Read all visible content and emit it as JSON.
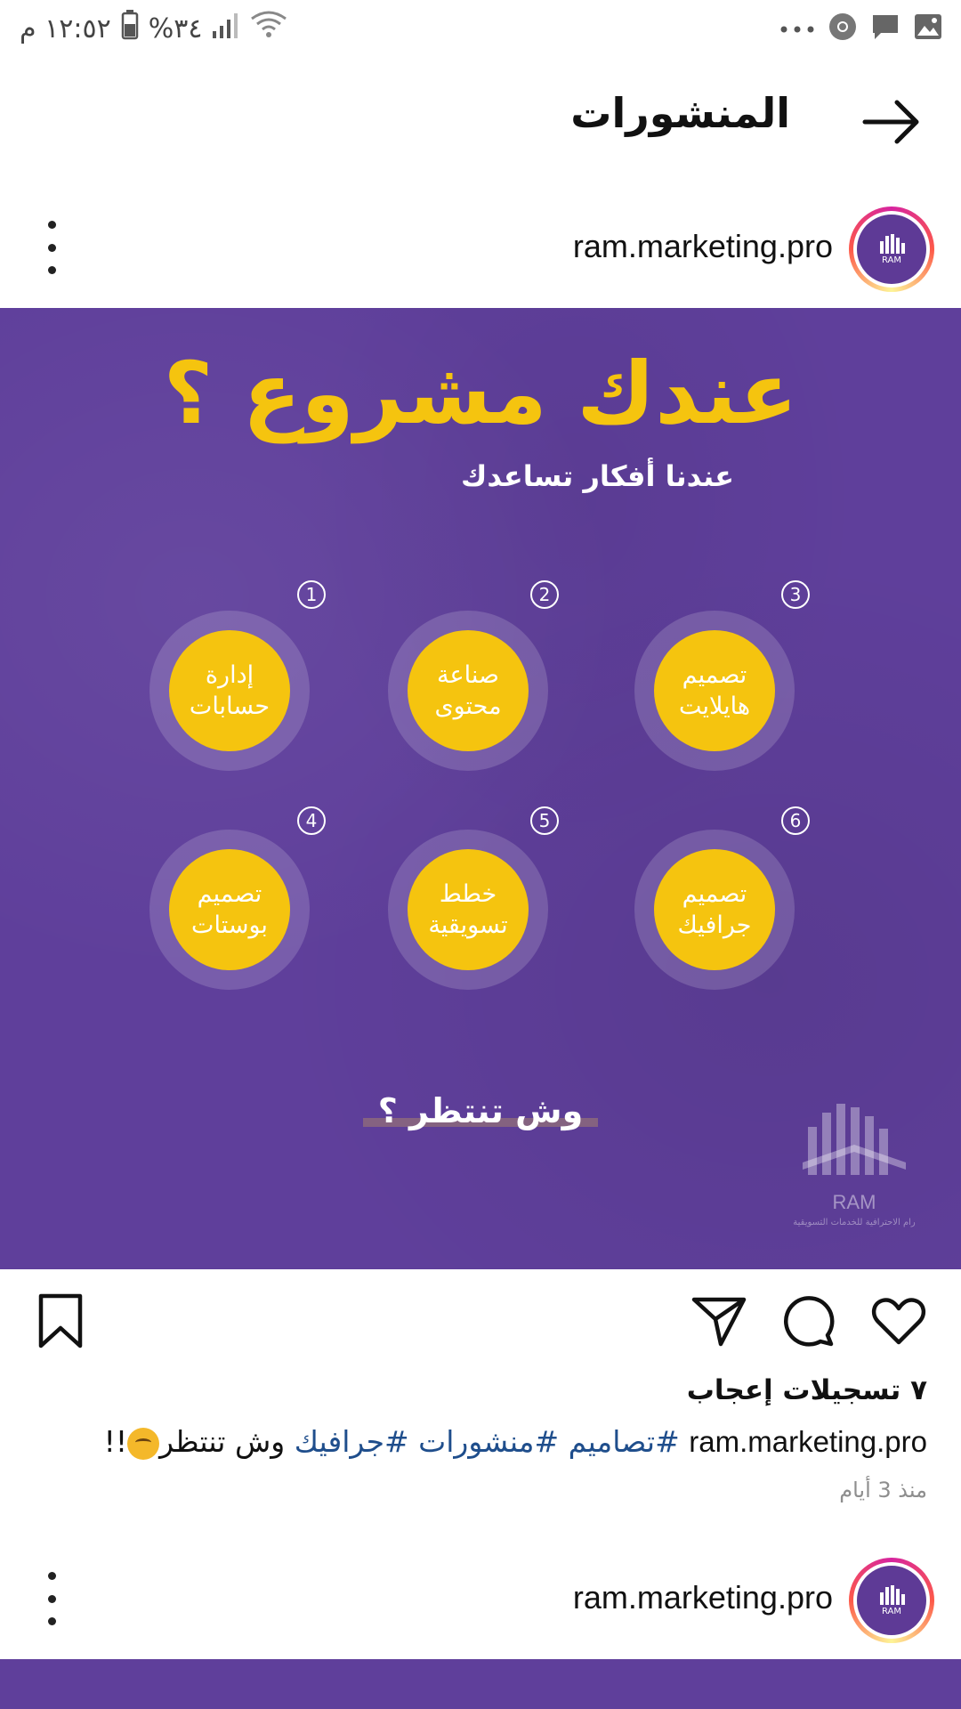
{
  "status_bar": {
    "time": "١٢:٥٢ م",
    "battery": "%٣٤"
  },
  "header": {
    "title": "المنشورات"
  },
  "posts": [
    {
      "username": "ram.marketing.pro",
      "avatar_text": "RAM",
      "image": {
        "title": "عندك مشروع ؟",
        "subtitle": "عندنا أفكار تساعدك",
        "services": [
          {
            "number": "3",
            "line1": "تصميم",
            "line2": "هايلايت"
          },
          {
            "number": "2",
            "line1": "صناعة",
            "line2": "محتوى"
          },
          {
            "number": "1",
            "line1": "إدارة",
            "line2": "حسابات"
          },
          {
            "number": "6",
            "line1": "تصميم",
            "line2": "جرافيك"
          },
          {
            "number": "5",
            "line1": "خطط",
            "line2": "تسويقية"
          },
          {
            "number": "4",
            "line1": "تصميم",
            "line2": "بوستات"
          }
        ],
        "cta": "وش تنتظر ؟",
        "logo_name": "RAM",
        "logo_tagline": "رام الاحترافية للخدمات التسويقية"
      },
      "likes": "٧ تسجيلات إعجاب",
      "caption": {
        "username": "ram.marketing.pro",
        "tags": [
          "#تصاميم",
          "#منشورات",
          "#جرافيك"
        ],
        "text": "وش تنتظر",
        "suffix": "!!"
      },
      "time_ago": "منذ 3 أيام"
    },
    {
      "username": "ram.marketing.pro",
      "avatar_text": "RAM"
    }
  ],
  "colors": {
    "purple": "#5f3f9b",
    "yellow": "#f5c40f",
    "hashtag": "#1f4e8c"
  }
}
